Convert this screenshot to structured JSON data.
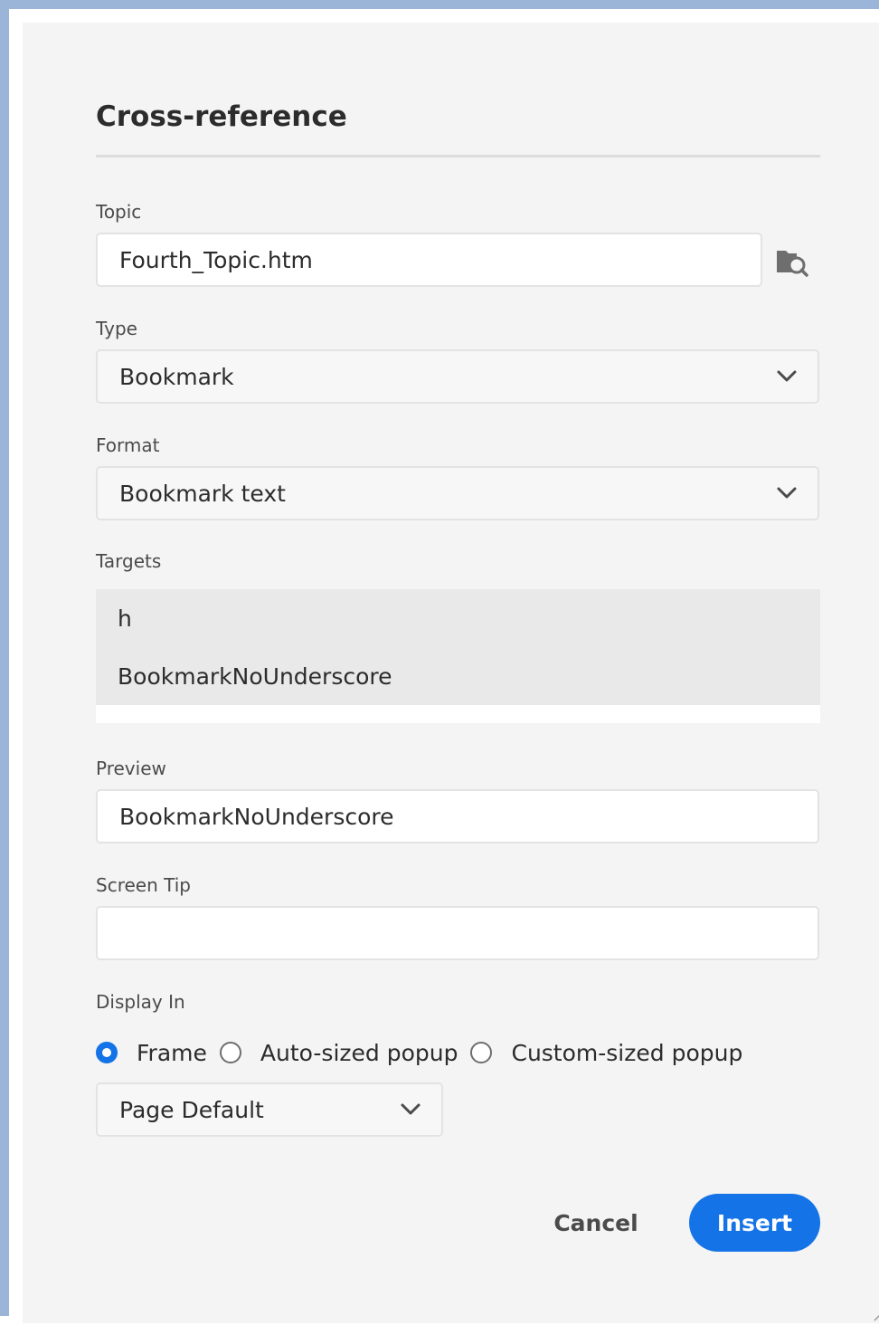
{
  "dialog": {
    "title": "Cross-reference"
  },
  "topic": {
    "label": "Topic",
    "value": "Fourth_Topic.htm",
    "browse_icon": "folder-search-icon"
  },
  "type": {
    "label": "Type",
    "value": "Bookmark"
  },
  "format": {
    "label": "Format",
    "value": "Bookmark text"
  },
  "targets": {
    "label": "Targets",
    "items": [
      "h",
      "BookmarkNoUnderscore"
    ]
  },
  "preview": {
    "label": "Preview",
    "value": "BookmarkNoUnderscore"
  },
  "screen_tip": {
    "label": "Screen Tip",
    "value": ""
  },
  "display_in": {
    "label": "Display In",
    "options": [
      "Frame",
      "Auto-sized popup",
      "Custom-sized popup"
    ],
    "selected": "Frame",
    "window_value": "Page Default"
  },
  "buttons": {
    "cancel": "Cancel",
    "insert": "Insert"
  },
  "colors": {
    "accent": "#1473e6",
    "dialog_bg": "#f4f4f4",
    "window_border": "#9bb5d8",
    "targets_bg": "#e9e9e9"
  }
}
